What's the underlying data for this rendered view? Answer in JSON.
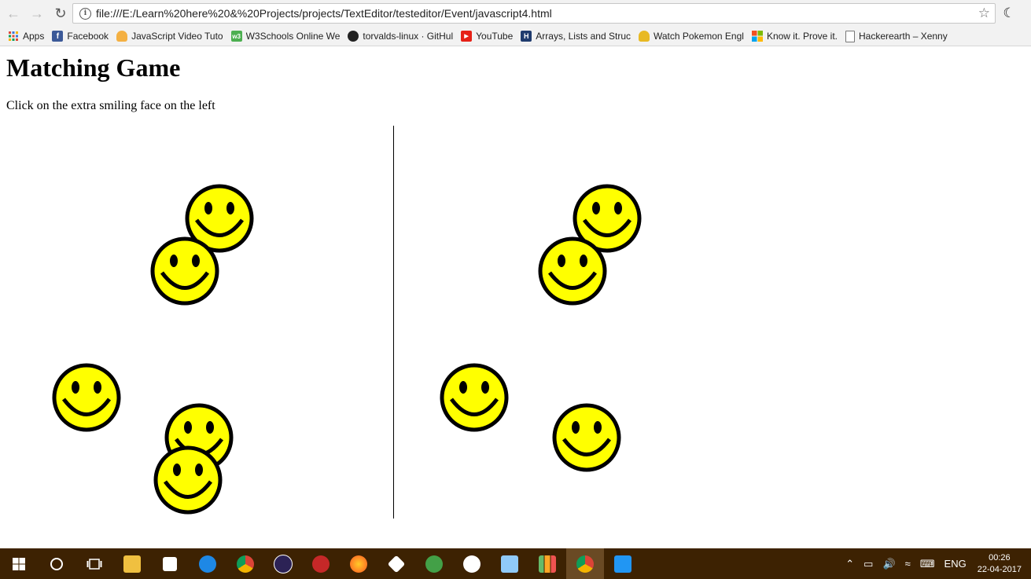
{
  "browser": {
    "url": "file:///E:/Learn%20here%20&%20Projects/projects/TextEditor/testeditor/Event/javascript4.html",
    "bookmarks": [
      {
        "label": "Apps",
        "icon": "apps-grid-icon",
        "color": "#e04a3a"
      },
      {
        "label": "Facebook",
        "icon": "facebook-icon",
        "color": "#3b5998"
      },
      {
        "label": "JavaScript Video Tuto",
        "icon": "cloud-icon",
        "color": "#f4b042"
      },
      {
        "label": "W3Schools Online We",
        "icon": "w3schools-icon",
        "color": "#4caf50"
      },
      {
        "label": "torvalds-linux · GitHul",
        "icon": "github-icon",
        "color": "#222222"
      },
      {
        "label": "YouTube",
        "icon": "youtube-icon",
        "color": "#e62117"
      },
      {
        "label": "Arrays, Lists and Struc",
        "icon": "hackerrank-icon",
        "color": "#1f3b6e"
      },
      {
        "label": "Watch Pokemon Engl",
        "icon": "pokemon-icon",
        "color": "#e8b923"
      },
      {
        "label": "Know it. Prove it.",
        "icon": "microsoft-icon",
        "color": "#f25022"
      },
      {
        "label": "Hackerearth – Xenny",
        "icon": "page-icon",
        "color": "#ffffff"
      }
    ]
  },
  "page": {
    "title": "Matching Game",
    "instructions": "Click on the extra smiling face on the left"
  },
  "game": {
    "face_colors": {
      "fill": "#ffff00",
      "stroke": "#000000"
    },
    "left_face_count": 5,
    "right_face_count": 4
  },
  "taskbar": {
    "apps": [
      {
        "name": "file-explorer-icon",
        "color": "#f0c040"
      },
      {
        "name": "store-icon",
        "color": "#ffffff"
      },
      {
        "name": "edge-icon",
        "color": "#1e88e5"
      },
      {
        "name": "chrome-icon",
        "color": "#4caf50"
      },
      {
        "name": "eclipse-icon",
        "color": "#2c2255"
      },
      {
        "name": "app-red-icon",
        "color": "#c62828"
      },
      {
        "name": "firefox-icon",
        "color": "#ff7043"
      },
      {
        "name": "unity-icon",
        "color": "#ffffff"
      },
      {
        "name": "app-green-icon",
        "color": "#43a047"
      },
      {
        "name": "unreal-icon",
        "color": "#ffffff"
      },
      {
        "name": "virtualbox-icon",
        "color": "#90caf9"
      },
      {
        "name": "chart-app-icon",
        "color": "#66bb6a"
      },
      {
        "name": "chrome-active-icon",
        "color": "#4caf50"
      },
      {
        "name": "vscode-icon",
        "color": "#2196f3"
      }
    ],
    "language": "ENG",
    "time": "00:26",
    "date": "22-04-2017"
  }
}
